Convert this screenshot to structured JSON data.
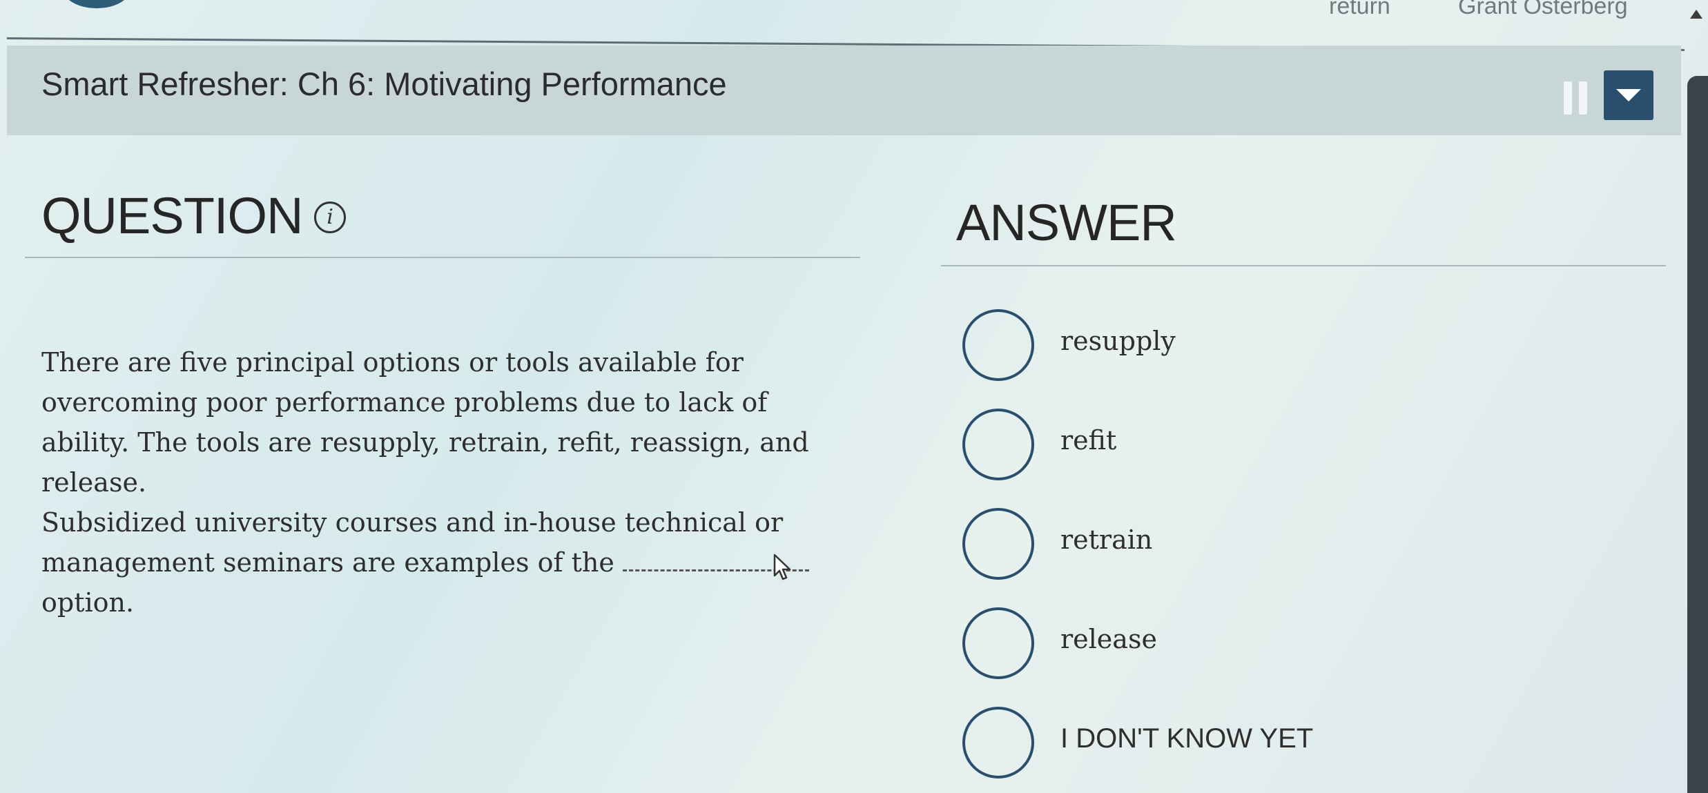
{
  "topbar": {
    "return_label": "return",
    "user_name": "Grant Osterberg"
  },
  "header": {
    "title": "Smart Refresher: Ch 6: Motivating Performance"
  },
  "question": {
    "heading": "QUESTION",
    "info_glyph": "i",
    "paragraph1": "There are five principal options or tools available for overcoming poor performance problems due to lack of ability. The tools are resupply, retrain, refit, reassign, and release.",
    "paragraph2_before": "Subsidized university courses and in-house technical or management seminars are examples of the",
    "paragraph2_after": "option."
  },
  "answer": {
    "heading": "ANSWER",
    "options": [
      {
        "label": "resupply"
      },
      {
        "label": "refit"
      },
      {
        "label": "retrain"
      },
      {
        "label": "release"
      },
      {
        "label": "I DON'T KNOW YET"
      }
    ]
  },
  "colors": {
    "accent": "#2a4f6c",
    "titlebar_bg": "#c8d6d8"
  }
}
